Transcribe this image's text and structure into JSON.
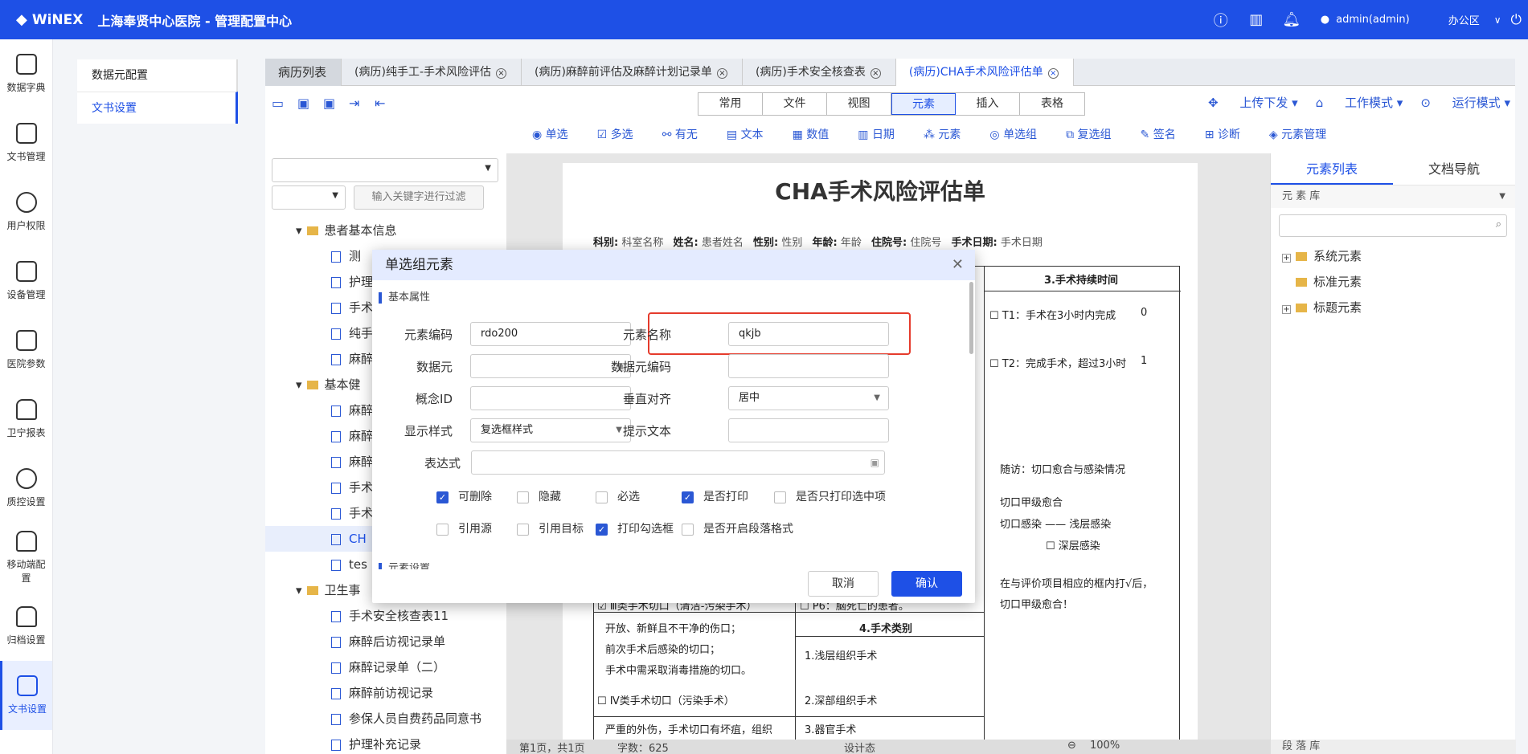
{
  "topbar": {
    "logo": "WiNEX",
    "title": "上海奉贤中心医院 - 管理配置中心",
    "user": "admin(admin)",
    "office": "办公区"
  },
  "leftnav": {
    "items": [
      {
        "label": "数据字典",
        "icon": "book-icon"
      },
      {
        "label": "文书管理",
        "icon": "doc-icon"
      },
      {
        "label": "用户权限",
        "icon": "user-icon"
      },
      {
        "label": "设备管理",
        "icon": "monitor-icon"
      },
      {
        "label": "医院参数",
        "icon": "sliders-icon"
      },
      {
        "label": "卫宁报表",
        "icon": "report-icon"
      },
      {
        "label": "质控设置",
        "icon": "shield-icon"
      },
      {
        "label": "移动端配置",
        "icon": "mobile-icon"
      },
      {
        "label": "归档设置",
        "icon": "archive-icon"
      },
      {
        "label": "文书设置",
        "icon": "doc-settings-icon"
      }
    ]
  },
  "subnav": {
    "items": [
      "数据元配置",
      "文书设置"
    ]
  },
  "tabs": {
    "list": "病历列表",
    "items": [
      "(病历)纯手工-手术风险评估",
      "(病历)麻醉前评估及麻醉计划记录单",
      "(病历)手术安全核查表",
      "(病历)CHA手术风险评估单"
    ]
  },
  "toolbar": {
    "modes": [
      "常用",
      "文件",
      "视图",
      "元素",
      "插入",
      "表格"
    ],
    "right": [
      "上传下发",
      "工作模式",
      "运行模式"
    ],
    "elements": [
      "单选",
      "多选",
      "有无",
      "文本",
      "数值",
      "日期",
      "元素",
      "单选组",
      "复选组",
      "签名",
      "诊断",
      "元素管理"
    ]
  },
  "leftpanel": {
    "filter_placeholder": "输入关键字进行过滤",
    "tree": [
      {
        "label": "患者基本信息",
        "level": 1
      },
      {
        "label": "测",
        "level": 2
      },
      {
        "label": "护理",
        "level": 2
      },
      {
        "label": "手术",
        "level": 2
      },
      {
        "label": "纯手",
        "level": 2
      },
      {
        "label": "麻醉",
        "level": 2
      },
      {
        "label": "基本健",
        "level": 1
      },
      {
        "label": "麻醉",
        "level": 2
      },
      {
        "label": "麻醉",
        "level": 2
      },
      {
        "label": "麻醉",
        "level": 2
      },
      {
        "label": "手术",
        "level": 2
      },
      {
        "label": "手术",
        "level": 2
      },
      {
        "label": "CH",
        "level": 2
      },
      {
        "label": "tes",
        "level": 2
      },
      {
        "label": "卫生事",
        "level": 1
      },
      {
        "label": "手术安全核查表11",
        "level": 2
      },
      {
        "label": "麻醉后访视记录单",
        "level": 2
      },
      {
        "label": "麻醉记录单（二）",
        "level": 2
      },
      {
        "label": "麻醉前访视记录",
        "level": 2
      },
      {
        "label": "参保人员自费药品同意书",
        "level": 2
      },
      {
        "label": "护理补充记录",
        "level": 2
      }
    ]
  },
  "document": {
    "title": "CHA手术风险评估单",
    "info": [
      {
        "k": "科别:",
        "v": "科室名称"
      },
      {
        "k": "姓名:",
        "v": "患者姓名"
      },
      {
        "k": "性别:",
        "v": "性别"
      },
      {
        "k": "年龄:",
        "v": "年龄"
      },
      {
        "k": "住院号:",
        "v": "住院号"
      },
      {
        "k": "手术日期:",
        "v": "手术日期"
      }
    ],
    "cells": {
      "c1": "3.手术持续时间",
      "c2": "T1：手术在3小时内完成",
      "c3": "T2：完成手术，超过3小时",
      "c4": "随访：切口愈合与感染情况",
      "c5": "切口甲级愈合",
      "c6": "切口感染 —— 浅层感染",
      "c7": "深层感染",
      "c8": "在与评价项目相应的框内打√后，",
      "c9": "切口甲级愈合！",
      "c10": "Ⅲ类手术切口（清洁-污染手术）",
      "c11": "P6：脑死亡的患者。",
      "c12": "开放、新鲜且不干净的伤口；",
      "c13": "前次手术后感染的切口；",
      "c14": "手术中需采取消毒措施的切口。",
      "c15": "4.手术类别",
      "c16": "1.浅层组织手术",
      "c17": "2.深部组织手术",
      "c18": "Ⅳ类手术切口（污染手术）",
      "c19": "严重的外伤，手术切口有坏疽，组织",
      "c20": "3.器官手术",
      "n0": "0",
      "n1": "1"
    }
  },
  "statusbar": {
    "page": "第1页，共1页",
    "words": "字数：625",
    "mode": "设计态",
    "zoom": "100%"
  },
  "rightpanel": {
    "tabs": [
      "元素列表",
      "文档导航"
    ],
    "lib": "元 素 库",
    "nodes": [
      "系统元素",
      "标准元素",
      "标题元素"
    ],
    "foot": "段 落 库"
  },
  "modal": {
    "title": "单选组元素",
    "section": "基本属性",
    "section2": "元素设置",
    "labels": {
      "code": "元素编码",
      "name": "元素名称",
      "dataelem": "数据元",
      "dataelem_code": "数据元编码",
      "concept": "概念ID",
      "valign": "垂直对齐",
      "style": "显示样式",
      "hint": "提示文本",
      "expr": "表达式"
    },
    "values": {
      "code": "rdo200",
      "name": "qkjb",
      "dataelem": "",
      "dataelem_code": "",
      "concept": "",
      "valign": "居中",
      "style": "复选框样式",
      "hint": "",
      "expr": ""
    },
    "checks": [
      {
        "label": "可删除",
        "on": true
      },
      {
        "label": "隐藏",
        "on": false
      },
      {
        "label": "必选",
        "on": false
      },
      {
        "label": "是否打印",
        "on": true
      },
      {
        "label": "是否只打印选中项",
        "on": false
      },
      {
        "label": "引用源",
        "on": false
      },
      {
        "label": "引用目标",
        "on": false
      },
      {
        "label": "打印勾选框",
        "on": true
      },
      {
        "label": "是否开启段落格式",
        "on": false
      }
    ],
    "cancel": "取消",
    "ok": "确认"
  }
}
